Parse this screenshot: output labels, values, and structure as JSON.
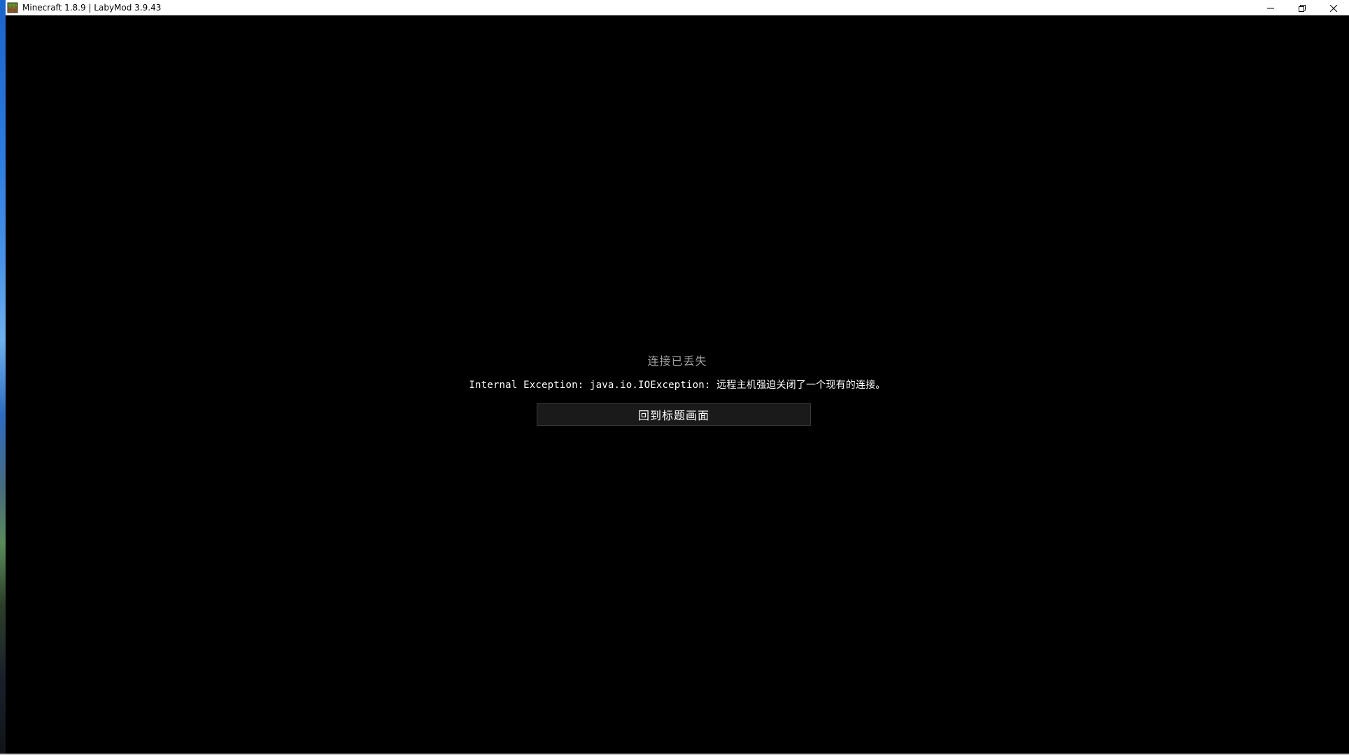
{
  "window": {
    "title": "Minecraft 1.8.9 | LabyMod 3.9.43",
    "app_icon": "minecraft-grass-block-icon",
    "controls": {
      "minimize_icon": "minimize-icon",
      "restore_icon": "restore-icon",
      "close_icon": "close-icon"
    }
  },
  "disconnected_screen": {
    "title": "连接已丢失",
    "reason": "Internal Exception: java.io.IOException: 远程主机强迫关闭了一个现有的连接。",
    "back_button_label": "回到标题画面"
  },
  "colors": {
    "background": "#000000",
    "title_text": "#a0a0a0",
    "reason_text": "#ffffff",
    "button_bg": "#1a1a1a"
  }
}
